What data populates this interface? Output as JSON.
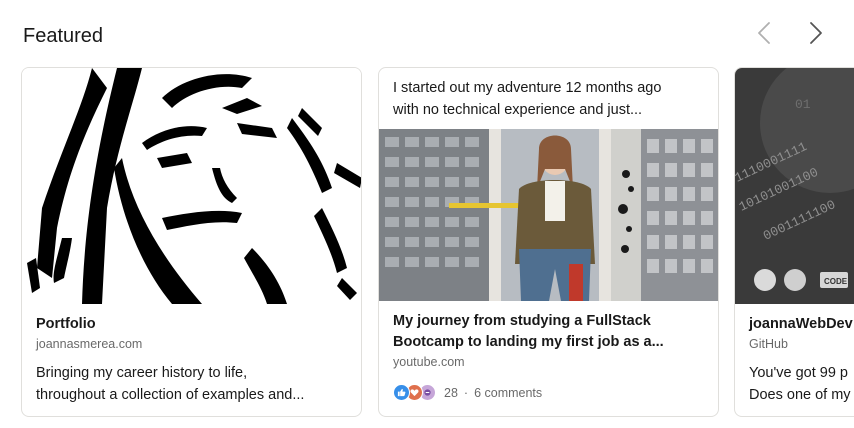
{
  "section": {
    "title": "Featured",
    "prev_icon": "chevron-left-icon",
    "next_icon": "chevron-right-icon"
  },
  "cards": [
    {
      "type": "link",
      "title": "Portfolio",
      "source": "joannasmerea.com",
      "description_line1": "Bringing my career history to life,",
      "description_line2": "throughout a collection of examples and..."
    },
    {
      "type": "post",
      "snippet_line1": "I started out my adventure 12 months ago",
      "snippet_line2": "with no technical experience and just...",
      "title_line1": "My journey from studying a FullStack",
      "title_line2": "Bootcamp to landing my first job as a...",
      "source": "youtube.com",
      "reaction_icons": [
        "like-icon",
        "love-icon",
        "support-icon"
      ],
      "reaction_count": "28",
      "separator": "·",
      "comments": "6 comments"
    },
    {
      "type": "link",
      "title": "joannaWebDev",
      "source": "GitHub",
      "description_line1": "You've got 99 p",
      "description_line2": "Does one of my"
    }
  ],
  "colors": {
    "border": "#e0dfdc",
    "like": "#378fe9",
    "love": "#df704d",
    "support": "#c6a6d8",
    "nav_prev": "#b0b0b0",
    "nav_next": "#666666"
  }
}
